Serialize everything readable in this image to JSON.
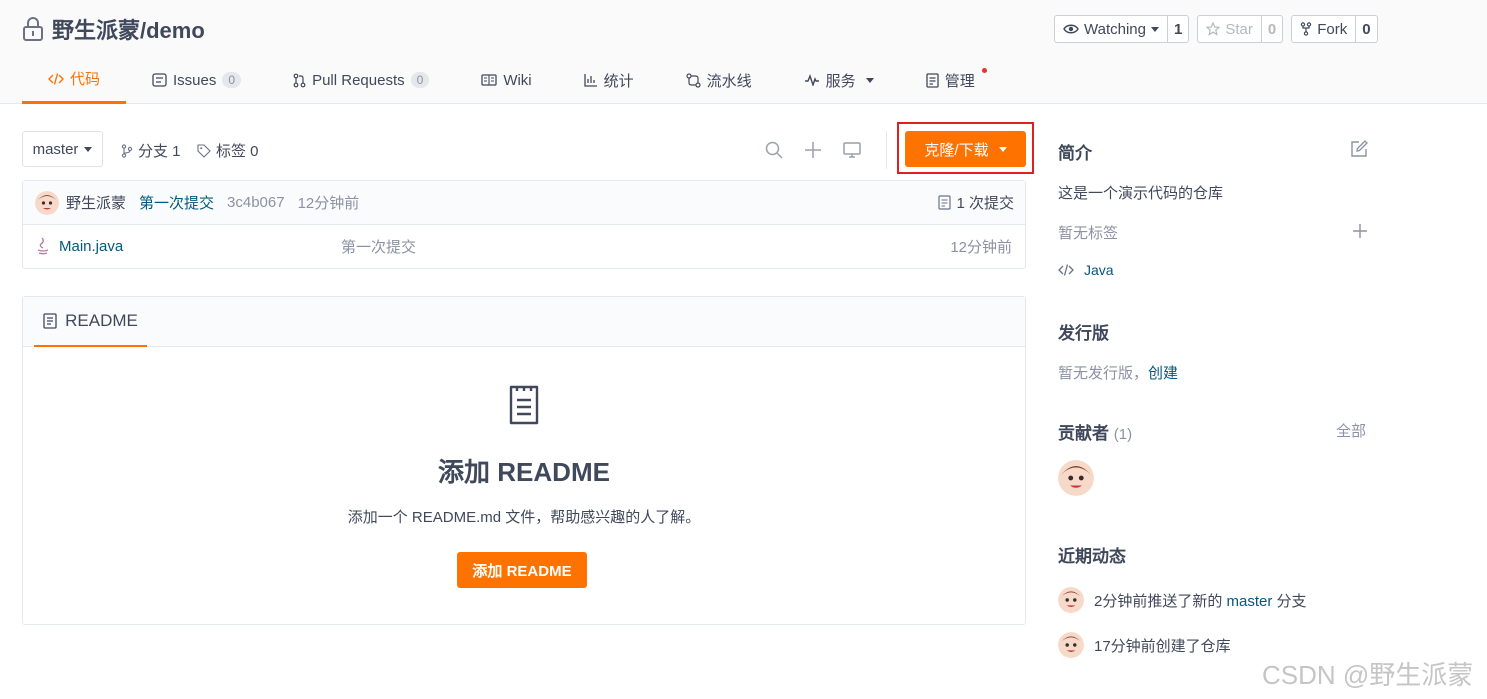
{
  "header": {
    "repo_name": "野生派蒙/demo",
    "watching": {
      "label": "Watching",
      "count": "1"
    },
    "star": {
      "label": "Star",
      "count": "0"
    },
    "fork": {
      "label": "Fork",
      "count": "0"
    }
  },
  "tabs": [
    {
      "label": "代码",
      "icon": "code-icon",
      "active": true
    },
    {
      "label": "Issues",
      "icon": "issues-icon",
      "badge": "0"
    },
    {
      "label": "Pull Requests",
      "icon": "pull-request-icon",
      "badge": "0"
    },
    {
      "label": "Wiki",
      "icon": "wiki-icon"
    },
    {
      "label": "统计",
      "icon": "chart-icon"
    },
    {
      "label": "流水线",
      "icon": "pipeline-icon"
    },
    {
      "label": "服务",
      "icon": "pulse-icon",
      "dropdown": true
    },
    {
      "label": "管理",
      "icon": "manage-icon",
      "notification": true
    }
  ],
  "toolbar": {
    "branch": "master",
    "branches_label": "分支 1",
    "tags_label": "标签 0",
    "clone_label": "克隆/下载"
  },
  "commit": {
    "author": "野生派蒙",
    "message": "第一次提交",
    "hash": "3c4b067",
    "time": "12分钟前",
    "count_label": "1 次提交"
  },
  "files": [
    {
      "name": "Main.java",
      "message": "第一次提交",
      "time": "12分钟前",
      "icon": "java-file-icon"
    }
  ],
  "readme": {
    "tab_label": "README",
    "empty_title": "添加 README",
    "empty_desc": "添加一个 README.md 文件，帮助感兴趣的人了解。",
    "add_button": "添加 README"
  },
  "sidebar": {
    "intro_title": "简介",
    "intro_text": "这是一个演示代码的仓库",
    "no_tags": "暂无标签",
    "language": "Java",
    "release_title": "发行版",
    "no_release": "暂无发行版，",
    "create_link": "创建",
    "contributors_title": "贡献者",
    "contributors_count": "(1)",
    "all_link": "全部",
    "activity_title": "近期动态",
    "activity": [
      {
        "prefix": "2分钟前推送了新的 ",
        "link": "master",
        "suffix": " 分支"
      },
      {
        "prefix": "17分钟前创建了仓库",
        "link": "",
        "suffix": ""
      }
    ]
  },
  "watermark": "CSDN @野生派蒙",
  "colors": {
    "accent": "#fe7300",
    "link": "#005980",
    "highlight_border": "#e02020"
  }
}
